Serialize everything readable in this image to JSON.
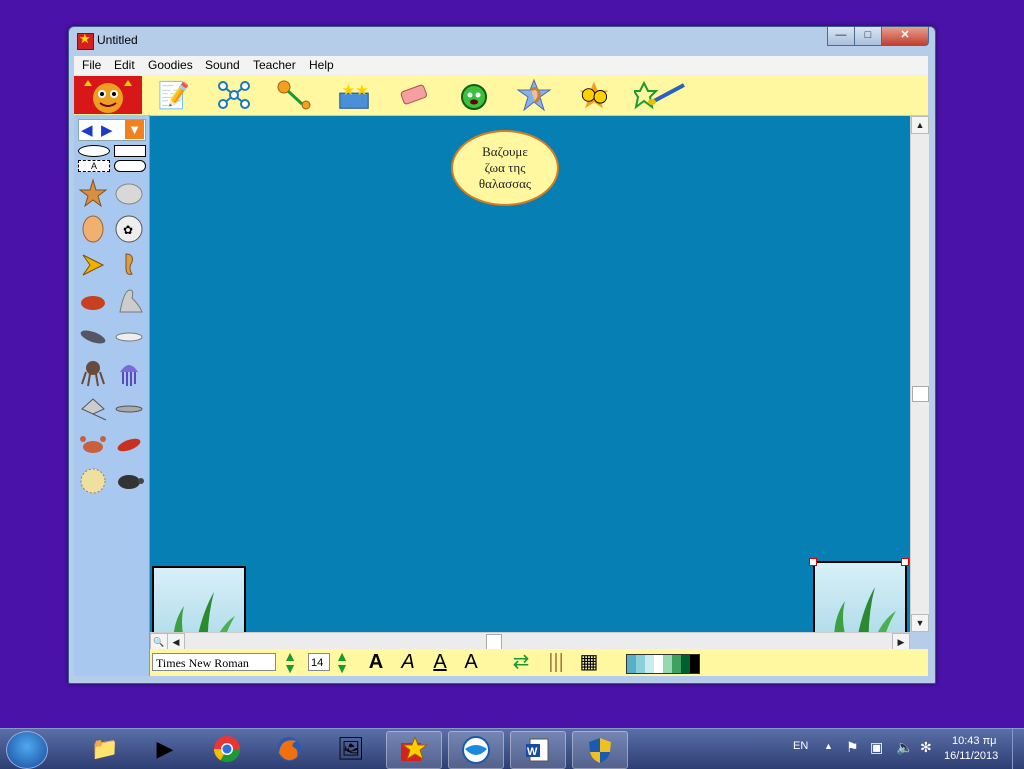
{
  "window": {
    "title": "Untitled",
    "controls": {
      "minimize": "—",
      "maximize": "□",
      "close": "✕"
    }
  },
  "menu": [
    "File",
    "Edit",
    "Goodies",
    "Sound",
    "Teacher",
    "Help"
  ],
  "toolbar_icons": [
    "pencil-paper-icon",
    "diagram-icon",
    "link-arrow-icon",
    "stars-box-icon",
    "eraser-icon",
    "talking-face-icon",
    "ear-icon",
    "faces-icon",
    "paintbrush-icon"
  ],
  "left_panel": {
    "nav": {
      "back": "◀",
      "forward": "▶",
      "dropdown": "▼"
    },
    "text_tool": "A",
    "stamps": [
      "starfish",
      "clam",
      "conch",
      "sand-dollar",
      "angelfish",
      "seahorse",
      "hermit-crab",
      "seal",
      "dolphin",
      "whale",
      "octopus",
      "jellyfish",
      "stingray",
      "shark",
      "crab",
      "lobster",
      "sea-urchin",
      "turtle"
    ]
  },
  "canvas": {
    "bubble_lines": [
      "Βαζουμε",
      "ζωα της",
      "θαλασσας"
    ],
    "background_color": "#067fb4"
  },
  "textbar": {
    "font": "Times New Roman",
    "size": "14",
    "style_letters": {
      "bold": "A",
      "italic": "A",
      "underline": "A",
      "superscript": "A"
    }
  },
  "taskbar": {
    "language": "EN",
    "time": "10:43 πμ",
    "date": "16/11/2013"
  }
}
